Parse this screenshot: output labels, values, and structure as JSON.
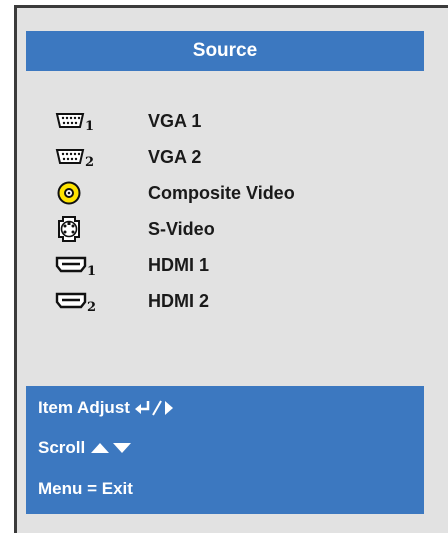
{
  "menu": {
    "title": "Source",
    "items": [
      {
        "label": "VGA 1",
        "icon": "vga-icon",
        "sub": "1"
      },
      {
        "label": "VGA 2",
        "icon": "vga-icon",
        "sub": "2"
      },
      {
        "label": "Composite Video",
        "icon": "composite-rca-icon"
      },
      {
        "label": "S-Video",
        "icon": "s-video-icon"
      },
      {
        "label": "HDMI 1",
        "icon": "hdmi-icon",
        "sub": "1"
      },
      {
        "label": "HDMI 2",
        "icon": "hdmi-icon",
        "sub": "2"
      }
    ]
  },
  "footer": {
    "item_adjust": "Item Adjust",
    "scroll": "Scroll",
    "menu_exit": "Menu = Exit"
  },
  "colors": {
    "title_bar": "#3c78c0",
    "panel": "#e2e2e2",
    "composite_yellow": "#ffe400"
  }
}
